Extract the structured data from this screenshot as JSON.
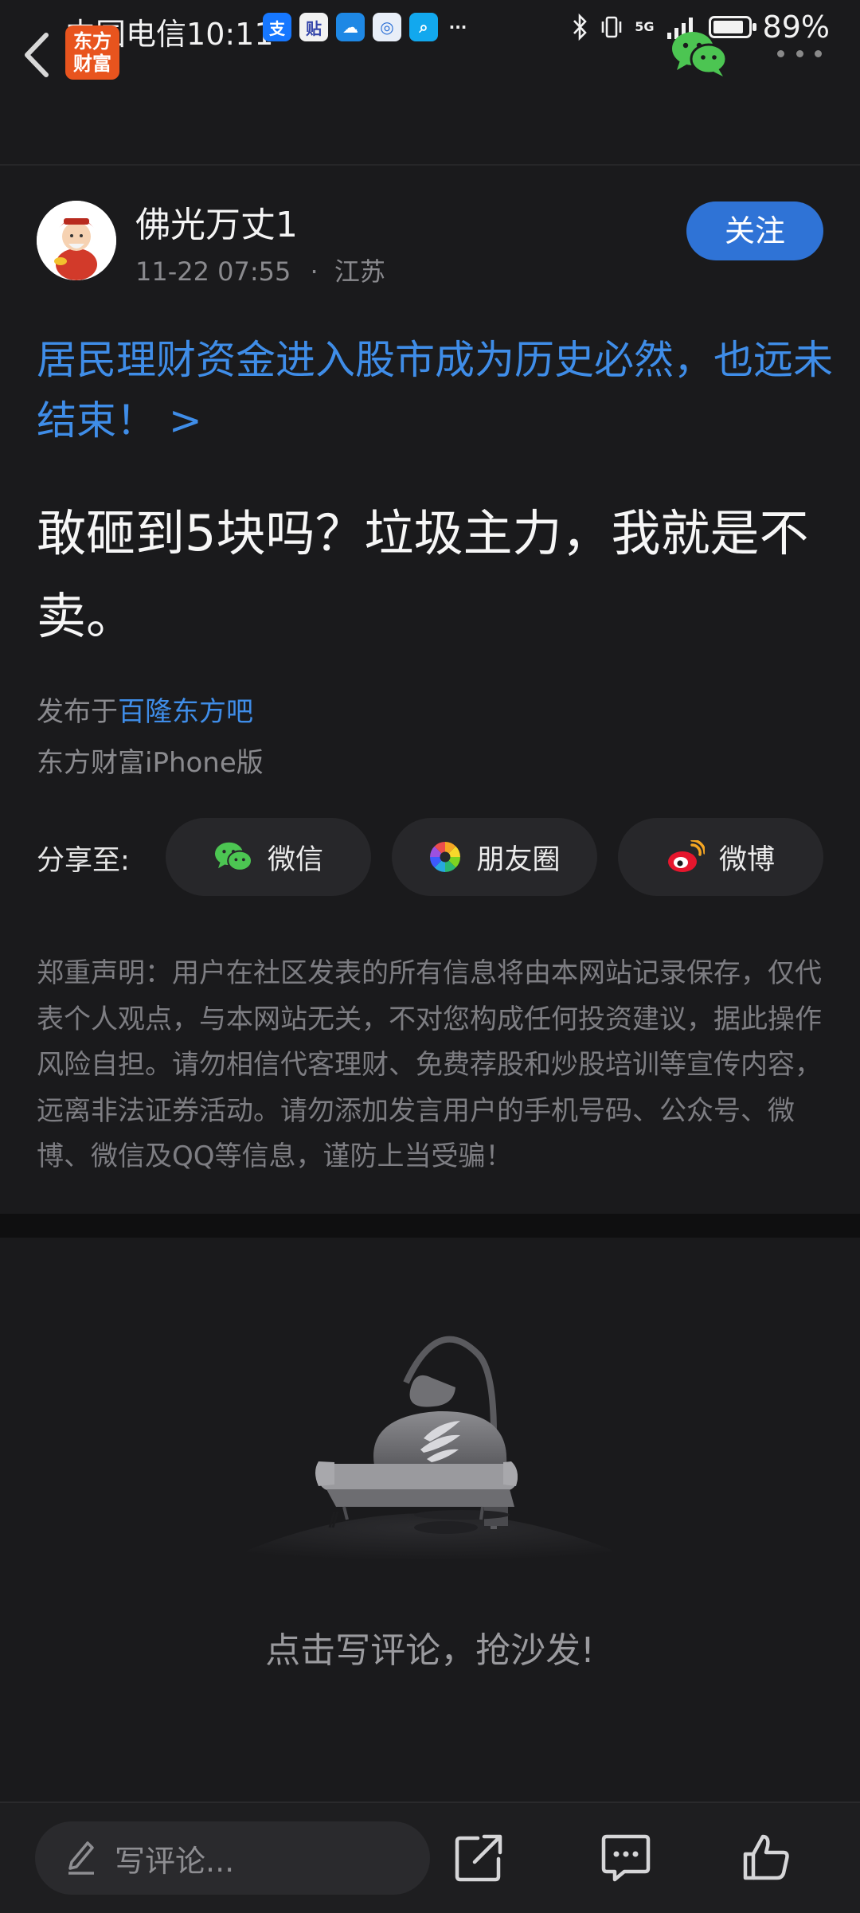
{
  "status_bar": {
    "carrier": "中国电信",
    "time": "10:11",
    "signal": "5G",
    "battery": "89%",
    "battery_level": 0.89,
    "app_icons": [
      "alipay-icon",
      "tieba-icon",
      "weather-icon",
      "browser-icon",
      "search-app-icon"
    ]
  },
  "nav": {
    "logo_line1": "东方",
    "logo_line2": "财富"
  },
  "author": {
    "name": "佛光万丈1",
    "datetime": "11-22 07:55",
    "separator": "·",
    "location": "江苏",
    "follow_label": "关注"
  },
  "topic_link": "居民理财资金进入股市成为历史必然，也远未结束！ >",
  "post": {
    "title": "敢砸到5块吗？垃圾主力，我就是不卖。",
    "publish_prefix": "发布于",
    "forum": "百隆东方吧",
    "client": "东方财富iPhone版"
  },
  "share": {
    "label": "分享至:",
    "wechat": "微信",
    "moments": "朋友圈",
    "weibo": "微博"
  },
  "disclaimer": "郑重声明：用户在社区发表的所有信息将由本网站记录保存，仅代表个人观点，与本网站无关，不对您构成任何投资建议，据此操作风险自担。请勿相信代客理财、免费荐股和炒股培训等宣传内容，远离非法证券活动。请勿添加发言用户的手机号码、公众号、微博、微信及QQ等信息，谨防上当受骗！",
  "empty_state": {
    "text": "点击写评论，抢沙发!"
  },
  "bottom_bar": {
    "comment_placeholder": "写评论..."
  },
  "colors": {
    "accent_blue": "#3f8de8",
    "follow_button": "#2f73d6",
    "logo_orange": "#e8541e",
    "wechat_green": "#4cc552",
    "background": "#1a1a1c"
  }
}
